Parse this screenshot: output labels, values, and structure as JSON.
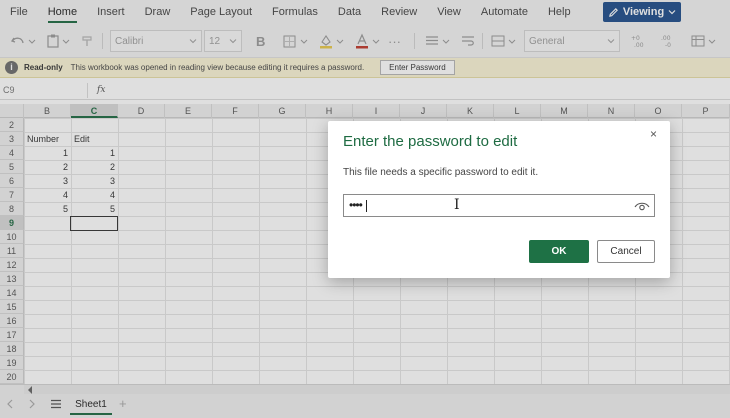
{
  "menu": {
    "items": [
      "File",
      "Home",
      "Insert",
      "Draw",
      "Page Layout",
      "Formulas",
      "Data",
      "Review",
      "View",
      "Automate",
      "Help"
    ],
    "active_index": 1,
    "viewing_label": "Viewing"
  },
  "toolbar": {
    "font_name": "Calibri",
    "font_size": "12",
    "bold_label": "B",
    "number_format": "General",
    "more_label": "···"
  },
  "infobar": {
    "title": "Read-only",
    "text": "This workbook was opened in reading view because editing it requires a password.",
    "button_label": "Enter Password",
    "icon": "i"
  },
  "formula_bar": {
    "name_box": "C9",
    "fx_label": "fx",
    "formula": ""
  },
  "grid": {
    "columns": [
      "B",
      "C",
      "D",
      "E",
      "F",
      "G",
      "H",
      "I",
      "J",
      "K",
      "L",
      "M",
      "N",
      "O",
      "P"
    ],
    "selected_column": "C",
    "rows": [
      "2",
      "3",
      "4",
      "5",
      "6",
      "7",
      "8",
      "9",
      "10",
      "11",
      "12",
      "13",
      "14",
      "15",
      "16",
      "17",
      "18",
      "19",
      "20"
    ],
    "selected_row": "9",
    "headers": {
      "b3": "Number",
      "c3": "Edit"
    },
    "data": [
      {
        "row": "4",
        "b": "1",
        "c": "1"
      },
      {
        "row": "5",
        "b": "2",
        "c": "2"
      },
      {
        "row": "6",
        "b": "3",
        "c": "3"
      },
      {
        "row": "7",
        "b": "4",
        "c": "4"
      },
      {
        "row": "8",
        "b": "5",
        "c": "5"
      }
    ]
  },
  "sheets": {
    "tabs": [
      "Sheet1"
    ],
    "add_label": "+"
  },
  "dialog": {
    "title": "Enter the password to edit",
    "message": "This file needs a specific password to edit it.",
    "password_value": "••••",
    "ok_label": "OK",
    "cancel_label": "Cancel",
    "close_label": "×"
  }
}
